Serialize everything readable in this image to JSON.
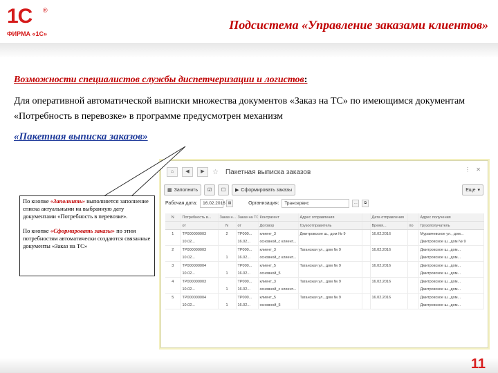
{
  "logo": {
    "mark": "1С",
    "registered": "®",
    "subtitle": "ФИРМА «1С»"
  },
  "header": {
    "title": "Подсистема «Управление заказами клиентов»"
  },
  "content": {
    "heading": "Возможности специалистов службы диспетчеризации и логистов",
    "heading_suffix": ":",
    "paragraph": "Для оперативной автоматической выписки множества документов «Заказ на ТС» по имеющимся документам «Потребность в перевозке» в программе предусмотрен механизм",
    "link": "«Пакетная выписка заказов»"
  },
  "callout": {
    "p1_prefix": "По кнопке ",
    "p1_button": "«Заполнить»",
    "p1_suffix": " выполняется заполнение списка актуальными на выбранную дату документами «Потребность в перевозке».",
    "p2_prefix": "По кнопке ",
    "p2_button": "«Сформировать заказы»",
    "p2_suffix": " по этим потребностям автоматически создаются связанные документы «Заказ на ТС»"
  },
  "app_window": {
    "title": "Пакетная выписка заказов",
    "toolbar": {
      "fill_label": "Заполнить",
      "form_orders_label": "Сформировать заказы",
      "more_label": "Еще"
    },
    "filters": {
      "date_label": "Рабочая дата:",
      "date_value": "16.02.2016",
      "org_label": "Организация:",
      "org_value": "Трансервис"
    },
    "table": {
      "header_row1": [
        "N",
        "Потребность в...",
        "Заказ н...",
        "Заказ на ТС",
        "Контрагент",
        "Адрес отправления",
        "",
        "Дата отправления",
        "",
        "Адрес получения"
      ],
      "header_row2": [
        "",
        "от",
        "N",
        "от",
        "Договор",
        "Грузоотправитель",
        "",
        "Время...",
        "по",
        "Грузополучатель"
      ],
      "rows": [
        {
          "top": [
            "1",
            "ТР000000003",
            "2",
            "ТР000...",
            "клиент_3",
            "Дмитровское ш., дом № 9",
            "",
            "16.02.2016",
            "",
            "Муравчевское ул., дом..."
          ],
          "bottom": [
            "",
            "10.02...",
            "",
            "16.02...",
            "основной_с клиент...",
            "",
            "",
            "",
            "",
            "Дмитровское ш., дом № 9"
          ]
        },
        {
          "top": [
            "2",
            "ТР000000003",
            "",
            "ТР000...",
            "клиент_3",
            "Таганская ул., дом № 9",
            "",
            "16.02.2016",
            "",
            "Дмитровское ш., дом..."
          ],
          "bottom": [
            "",
            "10.02...",
            "1",
            "16.02...",
            "основной_с клиент...",
            "",
            "",
            "",
            "",
            "Дмитровское ш., дом..."
          ]
        },
        {
          "top": [
            "3",
            "ТР000000004",
            "",
            "ТР000...",
            "клиент_5",
            "Таганская ул., дом № 9",
            "",
            "16.02.2016",
            "",
            "Дмитровское ш., дом..."
          ],
          "bottom": [
            "",
            "10.02...",
            "1",
            "16.02...",
            "основной_5",
            "",
            "",
            "",
            "",
            "Дмитровское ш., дом..."
          ]
        },
        {
          "top": [
            "4",
            "ТР000000003",
            "",
            "ТР000...",
            "клиент_3",
            "Таганская ул., дом № 9",
            "",
            "16.02.2016",
            "",
            "Дмитровское ш., дом..."
          ],
          "bottom": [
            "",
            "10.02...",
            "1",
            "16.02...",
            "основной_с клиент...",
            "",
            "",
            "",
            "",
            "Дмитровское ш., дом..."
          ]
        },
        {
          "top": [
            "5",
            "ТР000000004",
            "",
            "ТР000...",
            "клиент_5",
            "Таганская ул., дом № 9",
            "",
            "16.02.2016",
            "",
            "Дмитровское ш., дом..."
          ],
          "bottom": [
            "",
            "10.02...",
            "1",
            "16.02...",
            "основной_5",
            "",
            "",
            "",
            "",
            "Дмитровское ш., дом..."
          ]
        }
      ]
    }
  },
  "footer": {
    "page_number": "11"
  },
  "colors": {
    "title_red": "#c00000",
    "link_blue": "#1f3b9b",
    "logo_red": "#d51b1b"
  }
}
